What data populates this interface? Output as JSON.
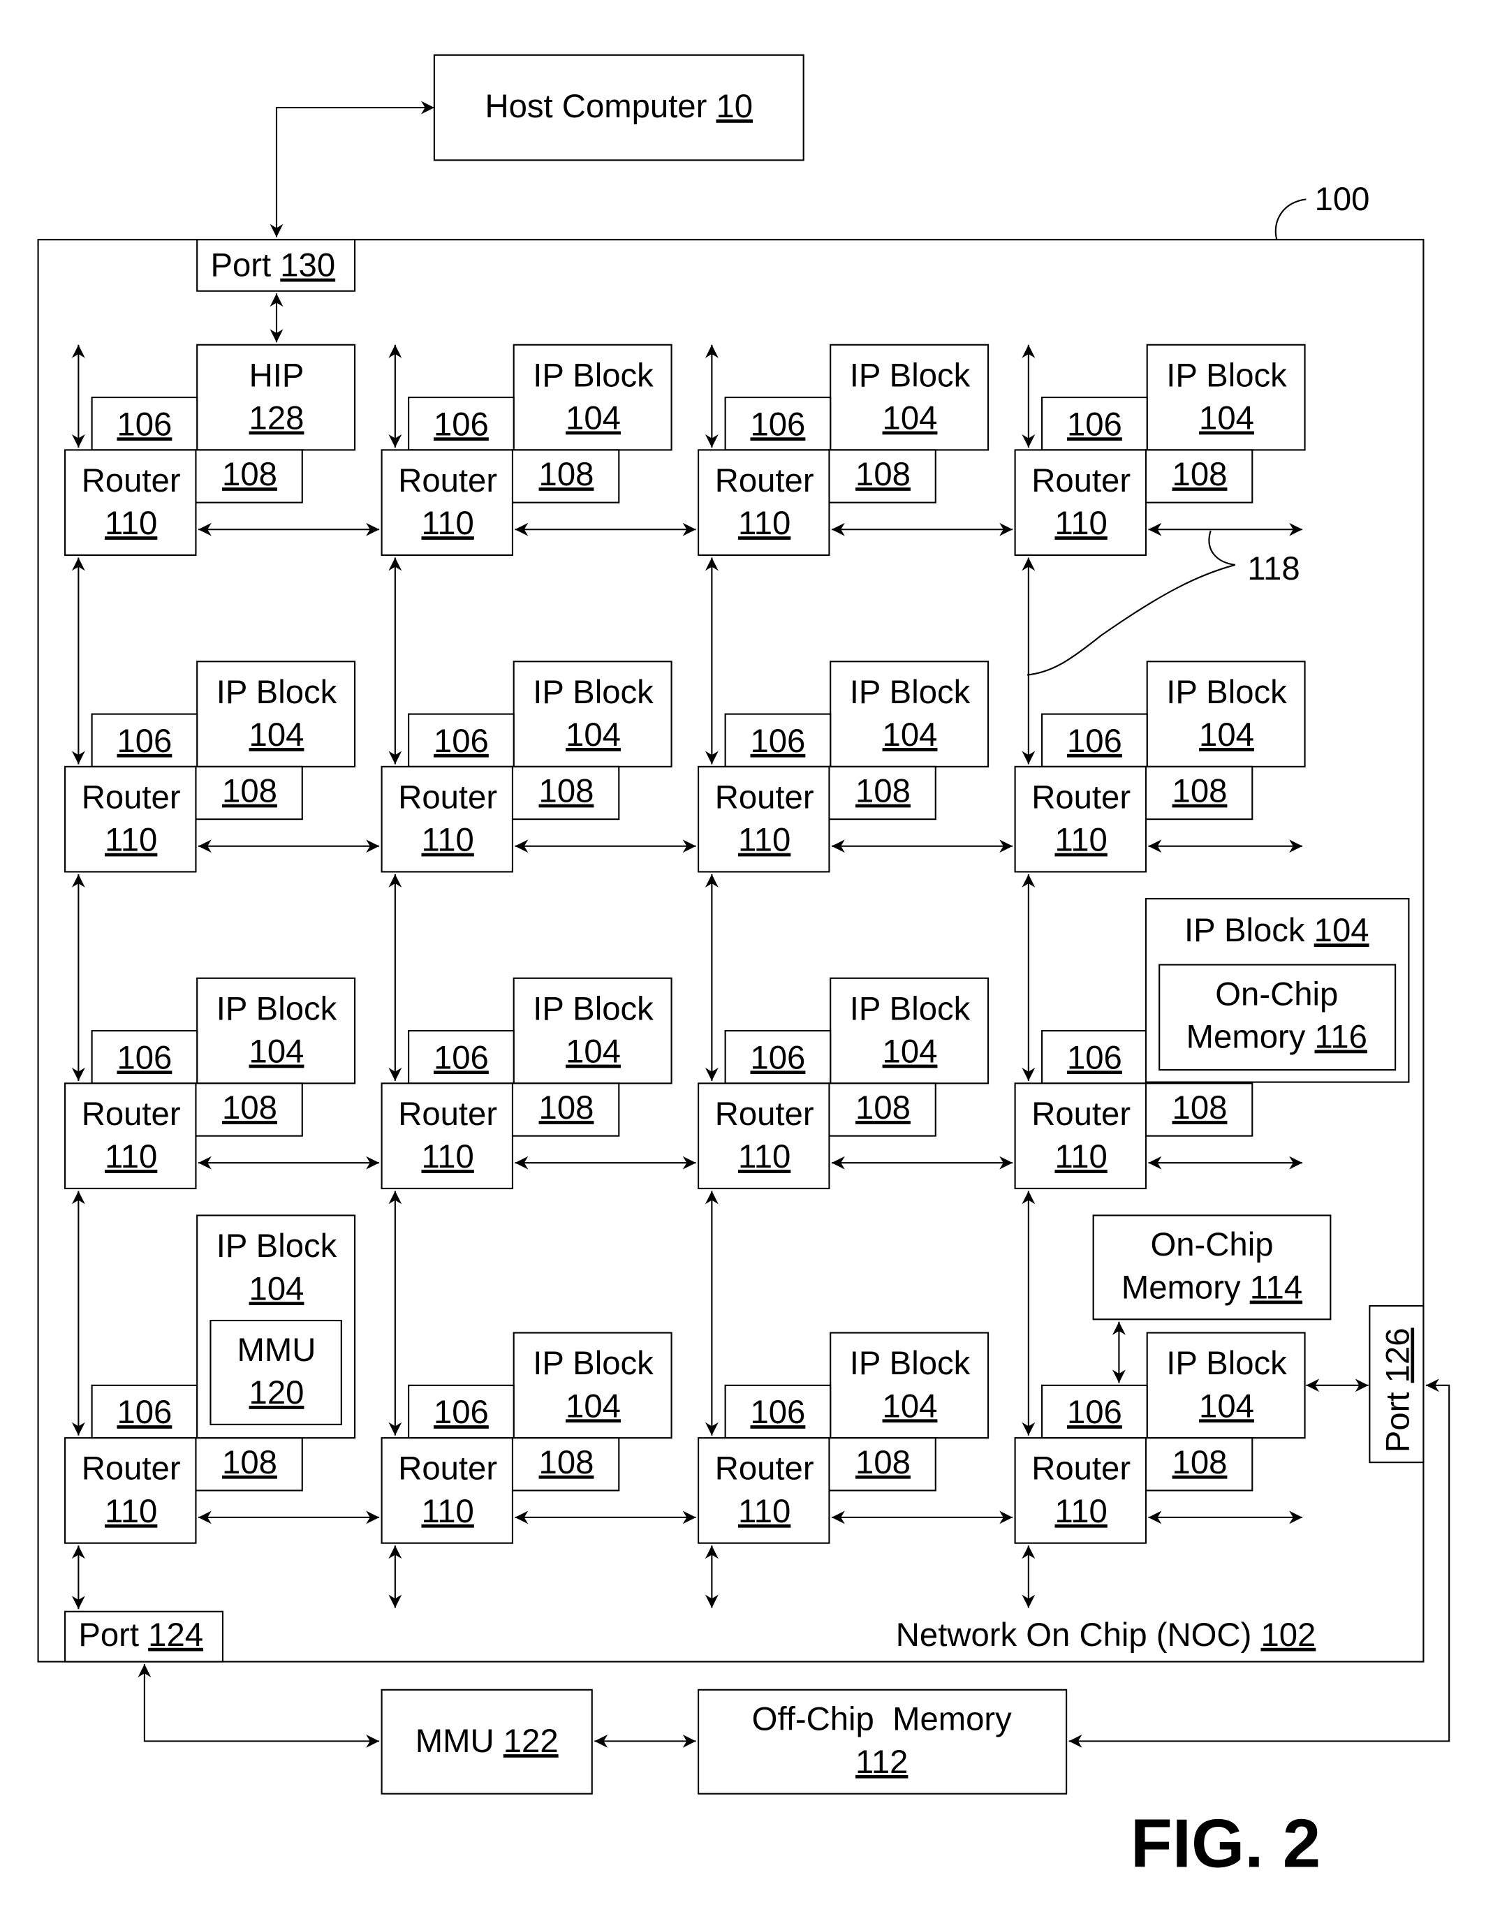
{
  "figure_label": "FIG. 2",
  "chip_ref": "100",
  "link_ref": "118",
  "host": {
    "label": "Host Computer",
    "ref": "10"
  },
  "noc": {
    "label": "Network On Chip (NOC)",
    "ref": "102"
  },
  "port130": {
    "label": "Port",
    "ref": "130"
  },
  "port124": {
    "label": "Port",
    "ref": "124"
  },
  "port126": {
    "label": "Port",
    "ref": "126"
  },
  "hip": {
    "label": "HIP",
    "ref": "128"
  },
  "ip_block": {
    "label": "IP Block",
    "ref": "104"
  },
  "router": {
    "label": "Router",
    "ref": "110"
  },
  "mem_iface_ref": "106",
  "net_iface_ref": "108",
  "mmu120": {
    "label": "MMU",
    "ref": "120"
  },
  "mmu122": {
    "label": "MMU",
    "ref": "122"
  },
  "onchip116": {
    "line1": "On-Chip",
    "line2": "Memory",
    "ref": "116"
  },
  "onchip114": {
    "line1": "On-Chip",
    "line2": "Memory",
    "ref": "114"
  },
  "offchip": {
    "label": "Off-Chip  Memory",
    "ref": "112"
  }
}
